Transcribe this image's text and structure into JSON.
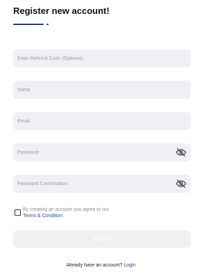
{
  "header": {
    "title": "Register new account!"
  },
  "form": {
    "referral": {
      "placeholder": "Enter Referral Code (Optional)",
      "value": ""
    },
    "name": {
      "placeholder": "Name",
      "value": ""
    },
    "email": {
      "placeholder": "Email",
      "value": ""
    },
    "password": {
      "placeholder": "Password",
      "value": "",
      "toggle_icon": "eye-off-icon"
    },
    "password_confirmation": {
      "placeholder": "Password Confirmation",
      "value": "",
      "toggle_icon": "eye-off-icon"
    },
    "terms": {
      "checked": false,
      "text": "By creating an account you agree to our",
      "link_text": "Terms & Condition"
    },
    "register_label": "Register"
  },
  "footer": {
    "prompt": "Already have an account?",
    "login_label": "Login"
  },
  "colors": {
    "accent": "#2c3e66",
    "link": "#2d4a8a",
    "field_bg": "#f0f0f4",
    "placeholder": "#9a9aa3"
  }
}
